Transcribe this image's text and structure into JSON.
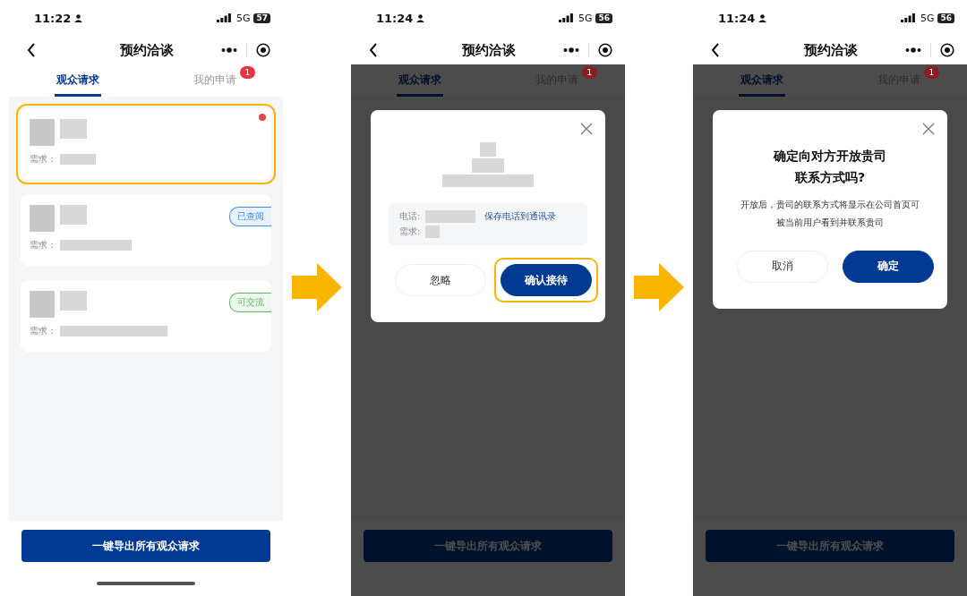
{
  "screens": [
    {
      "status": {
        "time": "11:22",
        "network": "5G",
        "battery": "57"
      },
      "title": "预约洽谈",
      "tabs": [
        {
          "label": "观众请求",
          "selected": true
        },
        {
          "label": "我的申请",
          "selected": false,
          "badge": "1"
        }
      ],
      "cards": [
        {
          "label": "需求：",
          "unread": true,
          "highlighted": true
        },
        {
          "label": "需求：",
          "unread": false,
          "highlighted": false,
          "tag": {
            "text": "已查阅",
            "color": "#3b8de0"
          }
        },
        {
          "label": "需求：",
          "unread": false,
          "highlighted": false,
          "tag": {
            "text": "可交流",
            "color": "#5cb85c"
          }
        }
      ],
      "export_button": "一键导出所有观众请求",
      "dimmed": false,
      "home_indicator": true
    },
    {
      "status": {
        "time": "11:24",
        "network": "5G",
        "battery": "56"
      },
      "title": "预约洽谈",
      "tabs": [
        {
          "label": "观众请求",
          "selected": true
        },
        {
          "label": "我的申请",
          "selected": false,
          "badge": "1"
        }
      ],
      "export_button": "一键导出所有观众请求",
      "dimmed": true,
      "home_indicator": false,
      "dialog": {
        "kind": "contact",
        "phone_label": "电话:",
        "save_link": "保存电话到通讯录",
        "need_label": "需求:",
        "buttons": [
          {
            "label": "忽略",
            "primary": false,
            "highlighted": false
          },
          {
            "label": "确认接待",
            "primary": true,
            "highlighted": true
          }
        ]
      }
    },
    {
      "status": {
        "time": "11:24",
        "network": "5G",
        "battery": "56"
      },
      "title": "预约洽谈",
      "tabs": [
        {
          "label": "观众请求",
          "selected": true
        },
        {
          "label": "我的申请",
          "selected": false,
          "badge": "1"
        }
      ],
      "export_button": "一键导出所有观众请求",
      "dimmed": true,
      "home_indicator": false,
      "dialog": {
        "kind": "confirm",
        "title": "确定向对方开放贵司联系方式吗?",
        "message": "开放后，贵司的联系方式将显示在公司首页可被当前用户看到并联系贵司",
        "buttons": [
          {
            "label": "取消",
            "primary": false,
            "highlighted": false
          },
          {
            "label": "确定",
            "primary": true,
            "highlighted": false
          }
        ]
      }
    }
  ]
}
